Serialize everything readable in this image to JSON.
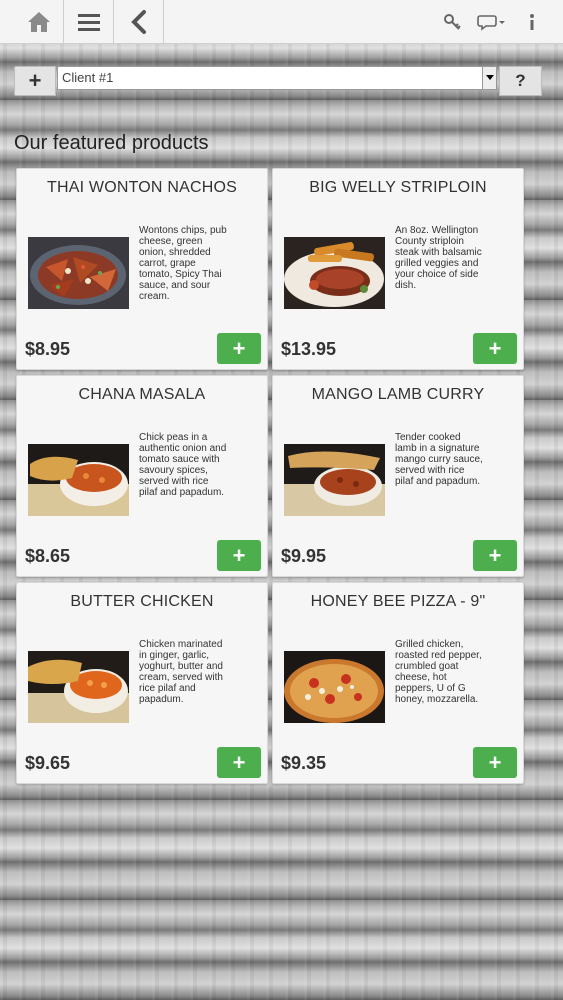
{
  "client": {
    "selected": "Client #1"
  },
  "section_title": "Our featured products",
  "products": [
    {
      "name": "THAI WONTON NACHOS",
      "description": "Wontons chips, pub cheese, green onion, shredded carrot, grape tomato, Spicy Thai sauce, and sour cream.",
      "price": "$8.95",
      "add_label": "+"
    },
    {
      "name": "BIG WELLY STRIPLOIN",
      "description": "An 8oz. Wellington County striploin steak with balsamic grilled veggies and your choice of side dish.",
      "price": "$13.95",
      "add_label": "+"
    },
    {
      "name": "CHANA MASALA",
      "description": "Chick peas in a authentic onion and tomato sauce with savoury spices, served with rice pilaf and papadum.",
      "price": "$8.65",
      "add_label": "+"
    },
    {
      "name": "MANGO LAMB CURRY",
      "description": "Tender cooked lamb in a signature mango curry sauce, served with rice pilaf and papadum.",
      "price": "$9.95",
      "add_label": "+"
    },
    {
      "name": "BUTTER CHICKEN",
      "description": "Chicken marinated in ginger, garlic, yoghurt, butter and cream, served with rice pilaf and papadum.",
      "price": "$9.65",
      "add_label": "+"
    },
    {
      "name": "HONEY BEE PIZZA - 9\"",
      "description": "Grilled chicken, roasted red pepper, crumbled goat cheese, hot peppers, U of G honey, mozzarella.",
      "price": "$9.35",
      "add_label": "+"
    }
  ],
  "buttons": {
    "add_client": "+",
    "help": "?"
  },
  "icons": {
    "home": "home-icon",
    "menu": "hamburger-icon",
    "back": "chevron-left-icon",
    "key": "key-icon",
    "chat": "chat-icon",
    "info": "info-icon"
  },
  "colors": {
    "accent_green": "#4cae4c",
    "card_bg": "#f6f6f6"
  }
}
